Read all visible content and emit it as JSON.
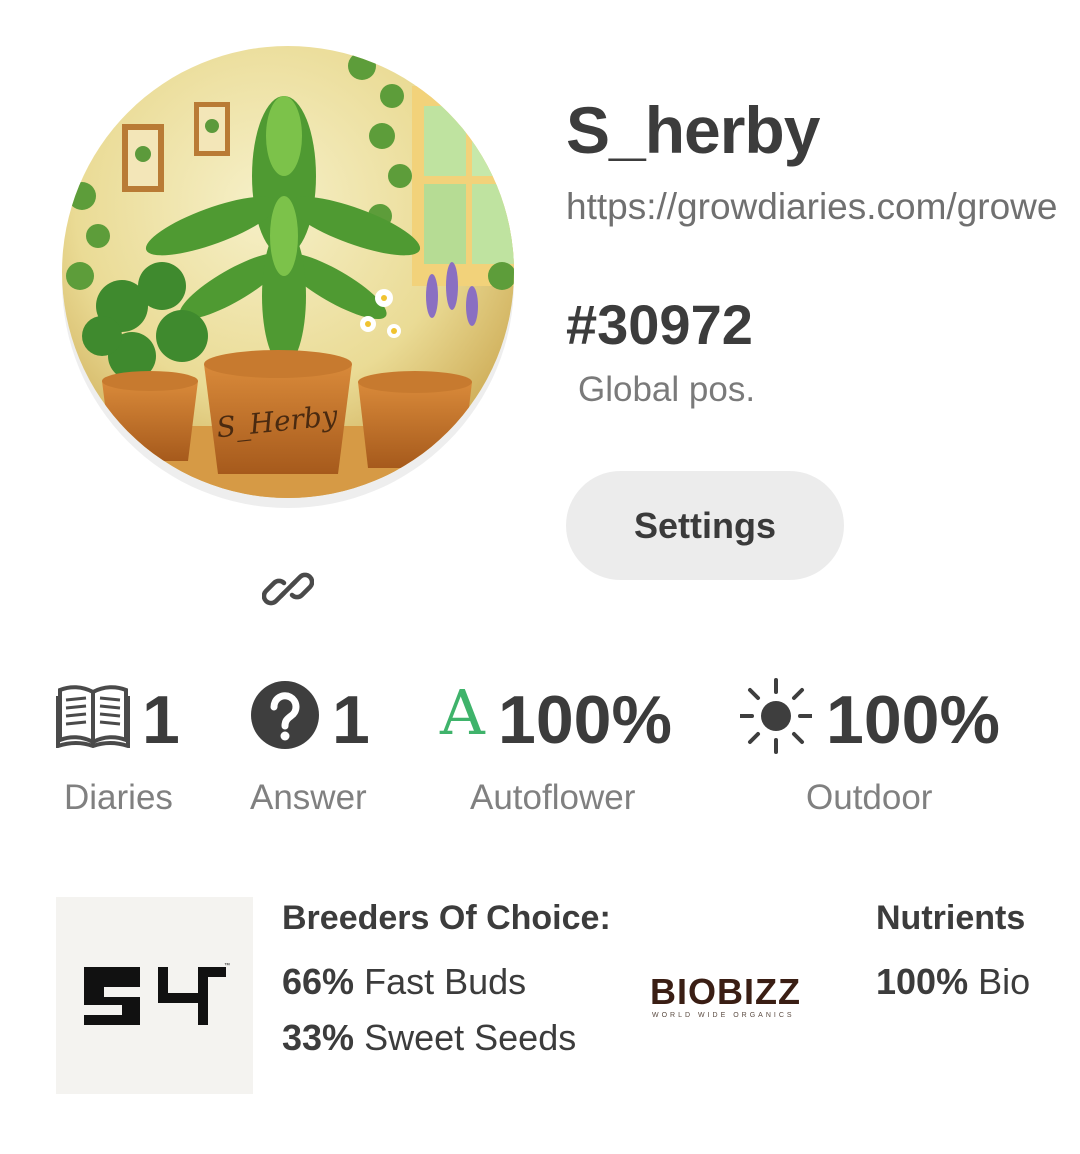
{
  "profile": {
    "username": "S_herby",
    "url": "https://growdiaries.com/growe",
    "rank": "#30972",
    "rank_label": "Global pos.",
    "settings_label": "Settings",
    "avatar_text": "S_Herby"
  },
  "stats": [
    {
      "icon": "open-book-icon",
      "value": "1",
      "label": "Diaries"
    },
    {
      "icon": "question-circle-icon",
      "value": "1",
      "label": "Answer"
    },
    {
      "icon": "autoflower-a-icon",
      "value": "100%",
      "label": "Autoflower",
      "glyph": "A",
      "color": "#3fb36b"
    },
    {
      "icon": "sun-icon",
      "value": "100%",
      "label": "Outdoor"
    }
  ],
  "breeders": {
    "heading": "Breeders Of Choice:",
    "items": [
      {
        "percent": "66%",
        "name": "Fast Buds"
      },
      {
        "percent": "33%",
        "name": "Sweet Seeds"
      }
    ],
    "logo": "fast-buds-logo"
  },
  "nutrients": {
    "heading": "Nutrients",
    "items": [
      {
        "percent": "100%",
        "name": "Bio"
      }
    ],
    "logo_text": "BIOBIZZ",
    "logo_sub": "WORLD WIDE ORGANICS"
  }
}
